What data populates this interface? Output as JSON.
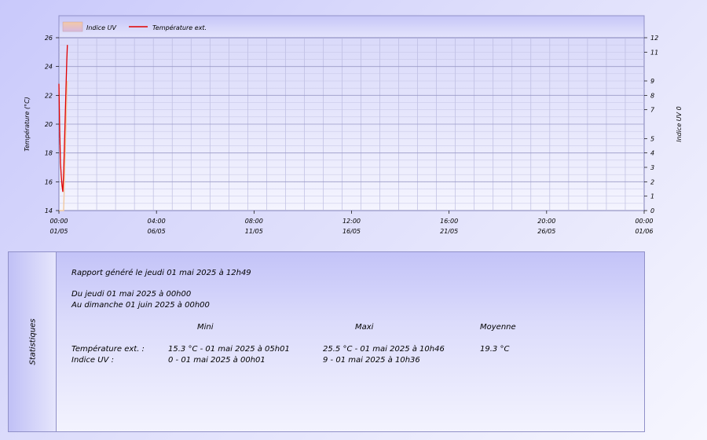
{
  "chart_data": {
    "type": "line",
    "legend": [
      {
        "label": "Indice UV",
        "color": "#f0c8a0"
      },
      {
        "label": "Température ext.",
        "color": "#e00000"
      }
    ],
    "ylabel": "Température (°C)",
    "y2label": "Indice UV 0",
    "ylim": [
      14,
      26
    ],
    "yticks": [
      "14",
      "16",
      "18",
      "20",
      "22",
      "24",
      "26"
    ],
    "y2lim": [
      0,
      12
    ],
    "y2ticks": [
      "0",
      "1",
      "2",
      "3",
      "4",
      "5",
      "7",
      "8",
      "9",
      "11",
      "12"
    ],
    "y2tick_values": [
      0,
      1,
      2,
      3,
      4,
      5,
      7,
      8,
      9,
      11,
      12
    ],
    "xlim_hours": [
      0,
      744
    ],
    "xticks": [
      {
        "time": "00:00",
        "date": "01/05"
      },
      {
        "time": "04:00",
        "date": "06/05"
      },
      {
        "time": "08:00",
        "date": "11/05"
      },
      {
        "time": "12:00",
        "date": "16/05"
      },
      {
        "time": "16:00",
        "date": "21/05"
      },
      {
        "time": "20:00",
        "date": "26/05"
      },
      {
        "time": "00:00",
        "date": "01/06"
      }
    ],
    "series": [
      {
        "name": "Température ext.",
        "color": "#e00000",
        "x_hours": [
          0.02,
          1,
          2,
          3,
          4,
          5,
          6,
          7,
          8,
          9,
          10,
          10.77
        ],
        "values": [
          22.8,
          19.5,
          17.3,
          16.4,
          15.7,
          15.3,
          16.6,
          18.5,
          20.5,
          22.5,
          24.4,
          25.5
        ]
      },
      {
        "name": "Indice UV",
        "color": "#f0c8a0",
        "x_hours": [
          0.02,
          1,
          2,
          3,
          4,
          5,
          6,
          7,
          8,
          9,
          10,
          10.6
        ],
        "values": [
          0,
          0,
          0,
          0,
          0,
          0,
          0,
          2,
          4,
          6,
          8,
          9
        ]
      }
    ]
  },
  "stats": {
    "side_label": "Statistiques",
    "report": "Rapport généré le jeudi 01 mai 2025 à 12h49",
    "from": "Du jeudi 01 mai 2025 à 00h00",
    "to": "Au dimanche 01 juin 2025 à 00h00",
    "col_min": "Mini",
    "col_max": "Maxi",
    "col_avg": "Moyenne",
    "rows": [
      {
        "label": "Température ext. :",
        "min": "15.3 °C - 01 mai 2025 à 05h01",
        "max": "25.5 °C - 01 mai 2025 à 10h46",
        "avg": "19.3 °C"
      },
      {
        "label": "Indice UV :",
        "min": "0 - 01 mai 2025 à 00h01",
        "max": "9 - 01 mai 2025 à 10h36",
        "avg": ""
      }
    ]
  }
}
